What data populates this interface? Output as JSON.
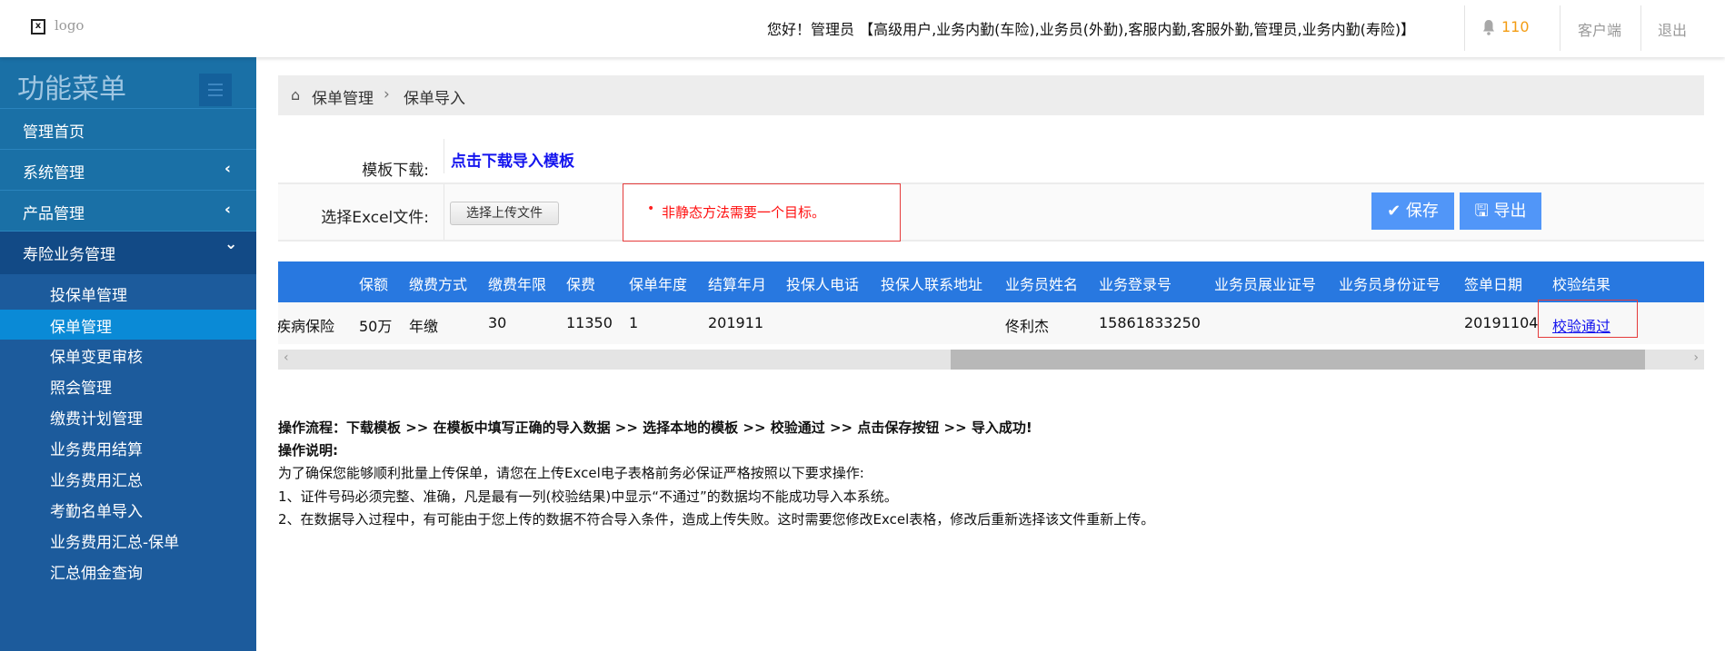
{
  "header": {
    "logo_text": "logo",
    "greeting": "您好！管理员 【高级用户,业务内勤(车险),业务员(外勤),客服内勤,客服外勤,管理员,业务内勤(寿险)】",
    "notification_count": "110",
    "client_link": "客户端",
    "logout_link": "退出"
  },
  "sidebar": {
    "title": "功能菜单",
    "top_items": [
      {
        "label": "管理首页"
      },
      {
        "label": "系统管理",
        "chevron": "‹"
      },
      {
        "label": "产品管理",
        "chevron": "‹"
      },
      {
        "label": "寿险业务管理",
        "chevron": "⌄"
      }
    ],
    "sub_items": [
      {
        "label": "投保单管理"
      },
      {
        "label": "保单管理"
      },
      {
        "label": "保单变更审核"
      },
      {
        "label": "照会管理"
      },
      {
        "label": "缴费计划管理"
      },
      {
        "label": "业务费用结算"
      },
      {
        "label": "业务费用汇总"
      },
      {
        "label": "考勤名单导入"
      },
      {
        "label": "业务费用汇总-保单"
      },
      {
        "label": "汇总佣金查询"
      }
    ]
  },
  "breadcrumb": {
    "items": [
      "保单管理",
      "保单导入"
    ],
    "separator": "›"
  },
  "form": {
    "template_label": "模板下载:",
    "template_link": "点击下载导入模板",
    "file_label": "选择Excel文件:",
    "upload_button": "选择上传文件",
    "error_message": "非静态方法需要一个目标。",
    "save_button": "保存",
    "export_button": "导出"
  },
  "table": {
    "headers": [
      "",
      "保额",
      "缴费方式",
      "缴费年限",
      "保费",
      "保单年度",
      "结算年月",
      "投保人电话",
      "投保人联系地址",
      "业务员姓名",
      "业务登录号",
      "业务员展业证号",
      "业务员身份证号",
      "签单日期",
      "校验结果"
    ],
    "rows": [
      [
        "疾病保险",
        "50万",
        "年缴",
        "30",
        "11350",
        "1",
        "201911",
        "",
        "",
        "佟利杰",
        "15861833250",
        "",
        "",
        "20191104",
        "校验通过"
      ]
    ]
  },
  "instructions": {
    "flow": "操作流程：下载模板 >> 在模板中填写正确的导入数据 >> 选择本地的模板 >> 校验通过 >> 点击保存按钮 >> 导入成功!",
    "title": "操作说明:",
    "intro": "为了确保您能够顺利批量上传保单，请您在上传Excel电子表格前务必保证严格按照以下要求操作:",
    "rule1": "1、证件号码必须完整、准确，凡是最有一列(校验结果)中显示“不通过”的数据均不能成功导入本系统。",
    "rule2": "2、在数据导入过程中，有可能由于您上传的数据不符合导入条件，造成上传失败。这时需要您修改Excel表格，修改后重新选择该文件重新上传。"
  },
  "colors": {
    "accent": "#2878e0",
    "button": "#5196f8",
    "error": "#ff1111",
    "link": "#1515ee"
  }
}
